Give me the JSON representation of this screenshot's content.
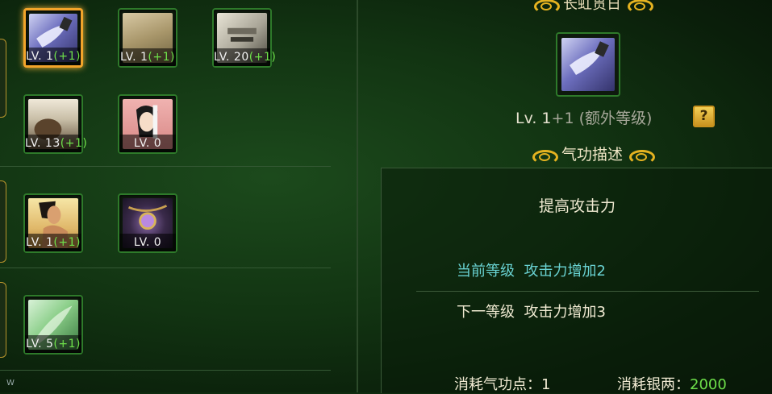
{
  "skills": [
    {
      "id": "s1",
      "level": "LV. 1",
      "bonus": "(+1)",
      "selected": true,
      "art": "blade"
    },
    {
      "id": "s2",
      "level": "LV. 1",
      "bonus": "(+1)",
      "selected": false,
      "art": "sand"
    },
    {
      "id": "s3",
      "level": "LV. 20",
      "bonus": "(+1)",
      "selected": false,
      "art": "scroll"
    },
    {
      "id": "s4",
      "level": "LV. 13",
      "bonus": "(+1)",
      "selected": false,
      "art": "hair"
    },
    {
      "id": "s5",
      "level": "LV. 0",
      "bonus": "",
      "selected": false,
      "art": "woman"
    },
    {
      "id": "s6",
      "level": "LV. 1",
      "bonus": "(+1)",
      "selected": false,
      "art": "man"
    },
    {
      "id": "s7",
      "level": "LV. 0",
      "bonus": "",
      "selected": false,
      "art": "ornament"
    },
    {
      "id": "s8",
      "level": "LV. 5",
      "bonus": "(+1)",
      "selected": false,
      "art": "leaf"
    }
  ],
  "corner_mark": "W",
  "detail": {
    "title": "长虹贯日",
    "level_prefix": "Lv. 1",
    "level_extra": "+1 (额外等级)",
    "help_label": "?",
    "desc_header": "气功描述",
    "effect": "提高攻击力",
    "current_label": "当前等级",
    "current_effect": "攻击力增加2",
    "next_label": "下一等级",
    "next_effect": "攻击力增加3",
    "cost_qi_label": "消耗气功点：",
    "cost_qi_value": "1",
    "cost_silver_label": "消耗银两：",
    "cost_silver_value": "2000"
  },
  "colors": {
    "accent_gold": "#e5b320",
    "bonus_green": "#6ee04a",
    "current_cyan": "#69d2d2",
    "selected_border": "#f2a42a"
  }
}
